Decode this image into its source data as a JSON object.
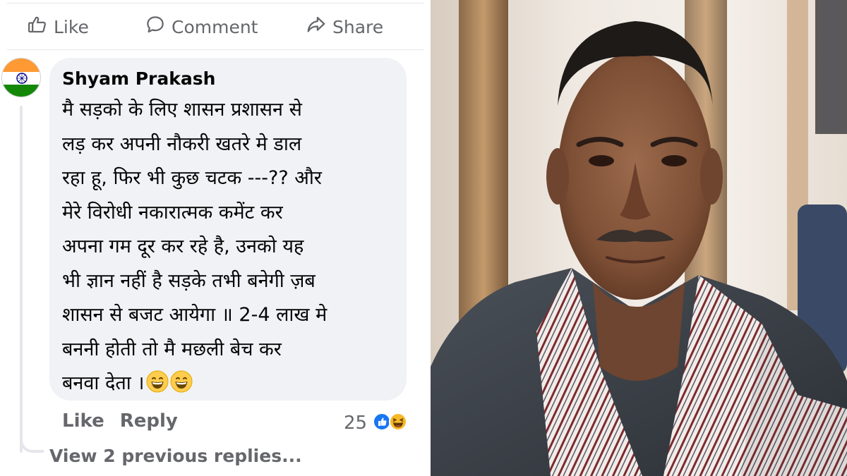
{
  "actions": {
    "like_label": "Like",
    "comment_label": "Comment",
    "share_label": "Share"
  },
  "comment": {
    "author": "Shyam Prakash",
    "avatar_icon": "indian-flag-avatar",
    "lines": [
      "मै सड़को के लिए शासन प्रशासन से",
      "लड़ कर अपनी नौकरी खतरे मे डाल",
      "रहा हू, फिर  भी कुछ चटक  ---?? और",
      "मेरे विरोधी नकारात्मक कमेंट कर",
      "अपना गम दूर कर रहे है, उनको यह",
      "भी ज्ञान नहीं है सड़के तभी बनेगी ज़ब",
      "शासन से बजट आयेगा ॥ 2-4 लाख मे",
      "बननी होती तो मै मछली बेच कर",
      "बनवा देता ।"
    ],
    "trailing_emojis": [
      "grinning-face-emoji",
      "grinning-face-emoji"
    ],
    "like_label": "Like",
    "reply_label": "Reply",
    "reaction_count": "25",
    "reaction_icons": [
      "like-reaction-icon",
      "haha-reaction-icon"
    ]
  },
  "replies": {
    "view_previous_label": "View 2 previous replies..."
  },
  "photo": {
    "subject": "portrait-photo"
  },
  "colors": {
    "secondary_text": "#65676b",
    "bubble_bg": "#f0f2f5",
    "primary_text": "#050505",
    "like_blue": "#1877f2",
    "haha_yellow": "#f7b928"
  }
}
